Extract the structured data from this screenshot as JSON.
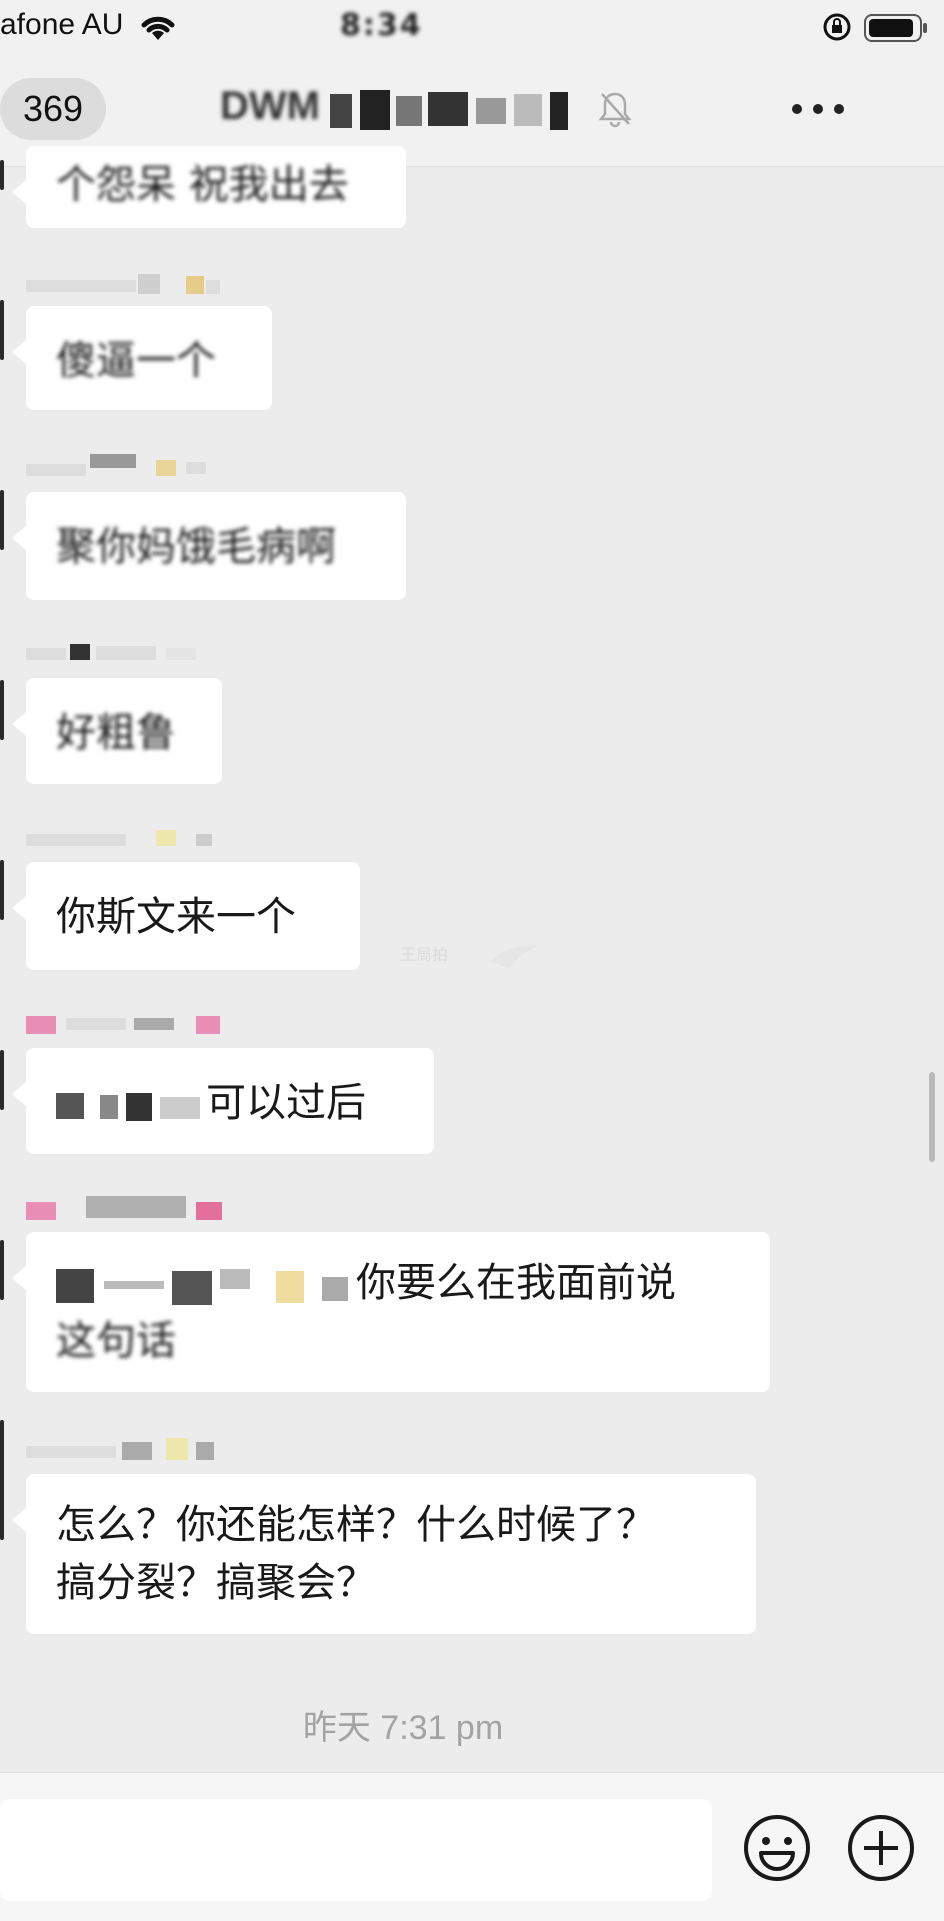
{
  "status_bar": {
    "carrier": "afone AU",
    "time": "8:34"
  },
  "header": {
    "back_count": "369",
    "chat_title": "DWM"
  },
  "messages": [
    {
      "text": "个怨呆 祝我出去"
    },
    {
      "text": "傻逼一个"
    },
    {
      "text": "聚你妈饿毛病啊"
    },
    {
      "text": "好粗鲁"
    },
    {
      "text": "你斯文来一个"
    },
    {
      "text": "可以过后"
    },
    {
      "text_line1": "你要么在我面前说",
      "text_line2": "这句话"
    },
    {
      "text_line1": "怎么？你还能怎样？什么时候了？",
      "text_line2": "搞分裂？搞聚会？"
    }
  ],
  "timestamp": "昨天 7:31 pm",
  "colors": {
    "background": "#ececed",
    "bubble": "#ffffff",
    "timestamp": "#a3a3a3"
  },
  "icons": [
    "wifi-icon",
    "rotation-lock-icon",
    "battery-icon",
    "mute-bell-icon",
    "more-icon",
    "emoji-icon",
    "plus-icon"
  ]
}
